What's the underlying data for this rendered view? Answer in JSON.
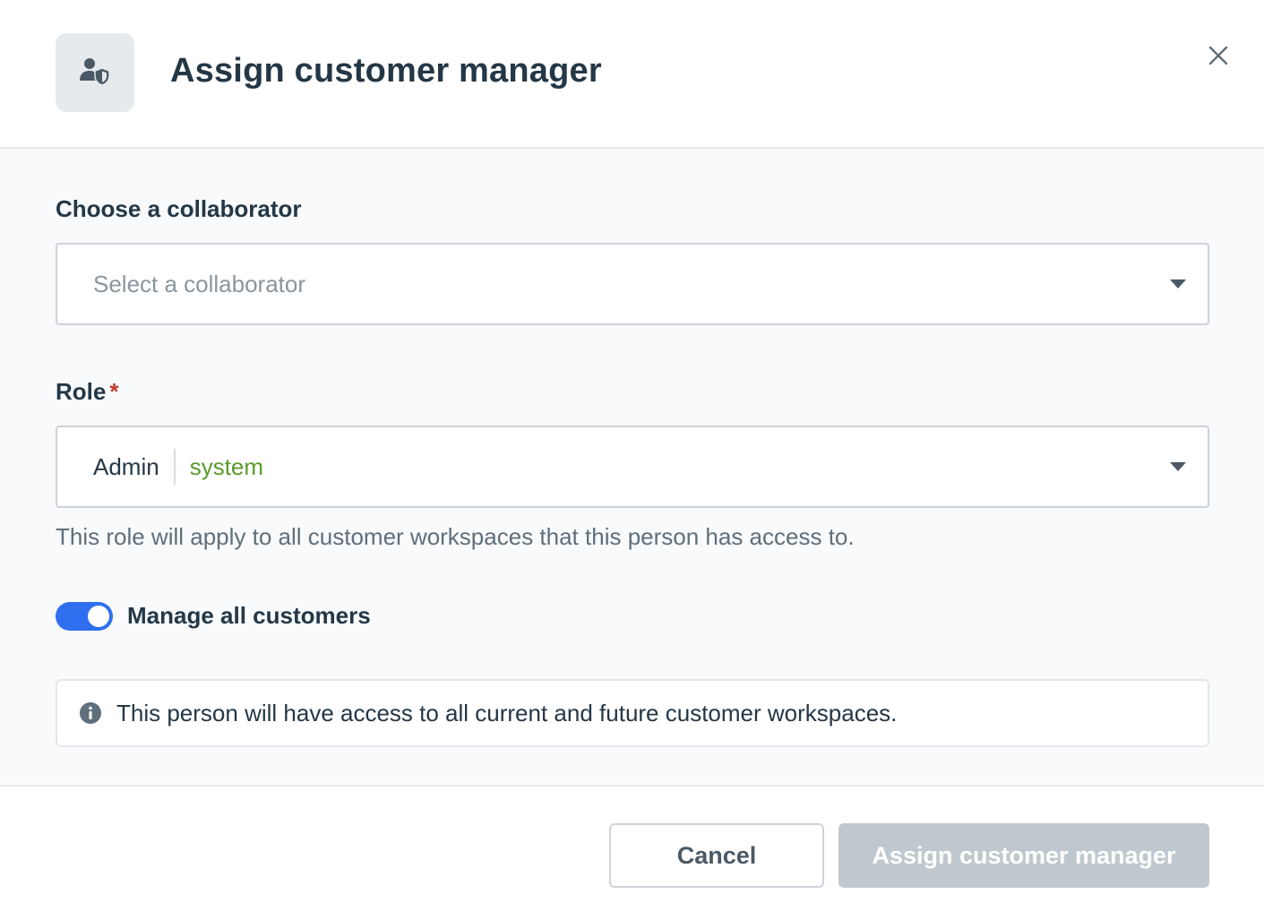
{
  "dialog": {
    "title": "Assign customer manager",
    "header_icon": "user-shield-icon",
    "close_icon": "close-icon"
  },
  "collaborator": {
    "label": "Choose a collaborator",
    "placeholder": "Select a collaborator"
  },
  "role": {
    "label": "Role",
    "required_mark": "*",
    "value": "Admin",
    "tag": "system",
    "hint": "This role will apply to all customer workspaces that this person has access to."
  },
  "manage_all": {
    "label": "Manage all customers",
    "enabled": true
  },
  "info": {
    "icon": "info-icon",
    "text": "This person will have access to all current and future customer workspaces."
  },
  "footer": {
    "cancel_label": "Cancel",
    "assign_label": "Assign customer manager"
  },
  "colors": {
    "toggle_on": "#2f6fef",
    "tag_green": "#5b9a2b",
    "required_red": "#c0392b",
    "disabled_button": "#c0c8cf"
  }
}
